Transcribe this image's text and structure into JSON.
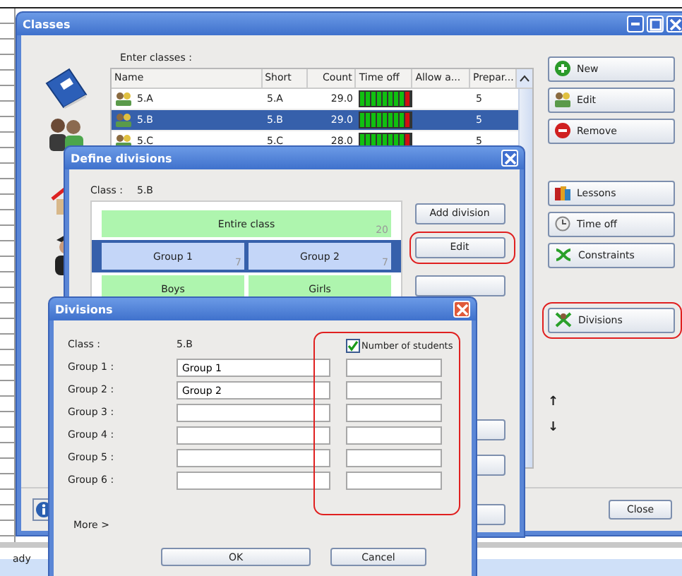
{
  "background": {
    "status_text": "ady"
  },
  "classes_window": {
    "title": "Classes",
    "prompt": "Enter classes :",
    "columns": [
      "Name",
      "Short",
      "Count",
      "Time off",
      "Allow a...",
      "Prepar..."
    ],
    "rows": [
      {
        "name": "5.A",
        "short": "5.A",
        "count": "29.0",
        "allow": "",
        "prep": "5",
        "selected": false
      },
      {
        "name": "5.B",
        "short": "5.B",
        "count": "29.0",
        "allow": "",
        "prep": "5",
        "selected": true
      },
      {
        "name": "5.C",
        "short": "5.C",
        "count": "28.0",
        "allow": "",
        "prep": "5",
        "selected": false
      }
    ],
    "buttons": [
      {
        "label": "New",
        "kind": "new",
        "highlighted": false
      },
      {
        "label": "Edit",
        "kind": "edit",
        "highlighted": false
      },
      {
        "label": "Remove",
        "kind": "remove",
        "highlighted": false
      },
      {
        "label": "Lessons",
        "kind": "lessons",
        "highlighted": false
      },
      {
        "label": "Time off",
        "kind": "timeoff",
        "highlighted": false
      },
      {
        "label": "Constraints",
        "kind": "constraints",
        "highlighted": false
      },
      {
        "label": "Divisions",
        "kind": "divisions",
        "highlighted": true
      }
    ],
    "arrows": [
      "↑",
      "↓"
    ],
    "close": "Close"
  },
  "define_divisions": {
    "title": "Define divisions",
    "class_label": "Class :",
    "class_value": "5.B",
    "divisions": [
      {
        "selected": false,
        "groups": [
          {
            "name": "Entire class",
            "count": "20"
          }
        ]
      },
      {
        "selected": true,
        "groups": [
          {
            "name": "Group 1",
            "count": "7"
          },
          {
            "name": "Group 2",
            "count": "7"
          }
        ]
      },
      {
        "selected": false,
        "groups": [
          {
            "name": "Boys"
          },
          {
            "name": "Girls"
          }
        ]
      }
    ],
    "buttons": [
      {
        "label": "Add division",
        "highlighted": false
      },
      {
        "label": "Edit",
        "highlighted": true
      }
    ]
  },
  "divisions_dialog": {
    "title": "Divisions",
    "class_label": "Class :",
    "class_value": "5.B",
    "students_checkbox": {
      "label": "Number of students",
      "checked": true,
      "highlighted": true
    },
    "groups": [
      {
        "label": "Group 1 :",
        "value": "Group 1"
      },
      {
        "label": "Group 2 :",
        "value": "Group 2"
      },
      {
        "label": "Group 3 :"
      },
      {
        "label": "Group 4 :"
      },
      {
        "label": "Group 5 :"
      },
      {
        "label": "Group 6 :"
      }
    ],
    "more": "More >",
    "buttons": [
      "OK",
      "Cancel"
    ]
  }
}
